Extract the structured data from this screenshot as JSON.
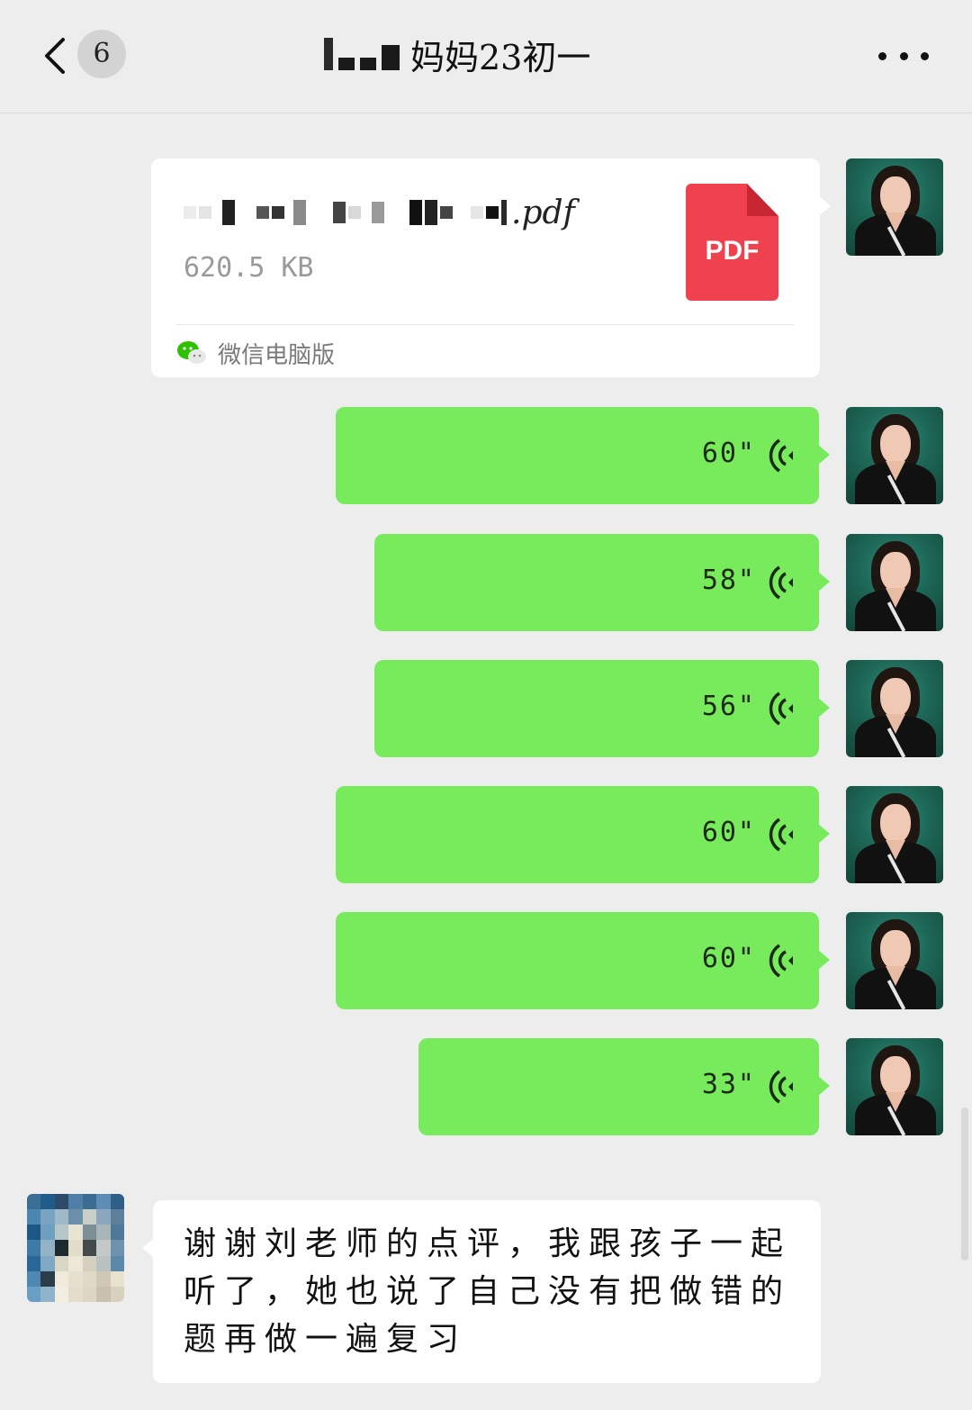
{
  "header": {
    "back_label": "<",
    "unread_count": "6",
    "title": "妈妈23初一",
    "more_label": "•••"
  },
  "messages": {
    "file": {
      "filename_suffix": ".pdf",
      "size": "620.5 KB",
      "icon_label": "PDF",
      "source": "微信电脑版"
    },
    "voice": [
      {
        "duration": "60\""
      },
      {
        "duration": "58\""
      },
      {
        "duration": "56\""
      },
      {
        "duration": "60\""
      },
      {
        "duration": "60\""
      },
      {
        "duration": "33\""
      }
    ],
    "reply": {
      "text": "谢谢刘老师的点评，我跟孩子一起听了，她也说了自己没有把做错的题再做一遍复习"
    }
  },
  "colors": {
    "background": "#ededed",
    "self_bubble": "#77eb5b",
    "pdf_red": "#f0424e"
  }
}
